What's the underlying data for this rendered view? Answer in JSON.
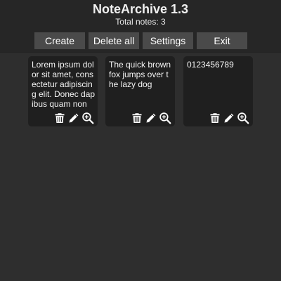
{
  "app": {
    "title": "NoteArchive 1.3",
    "note_count_text": "Total notes: 3"
  },
  "toolbar": {
    "create_label": "Create",
    "delete_all_label": "Delete all",
    "settings_label": "Settings",
    "exit_label": "Exit"
  },
  "notes": [
    {
      "text": "Lorem ipsum dolor sit amet, consectetur adipiscing elit. Donec dapibus quam non",
      "actions": [
        "trash-icon",
        "pencil-icon",
        "zoom-in-icon"
      ]
    },
    {
      "text": "The quick brown fox jumps over the lazy dog",
      "actions": [
        "trash-icon",
        "pencil-icon",
        "zoom-in-icon"
      ]
    },
    {
      "text": "0123456789",
      "actions": [
        "trash-icon",
        "pencil-icon",
        "zoom-in-icon"
      ]
    }
  ],
  "colors": {
    "background": "#2e2e2e",
    "header": "#262626",
    "button": "#4a4a4a",
    "card": "#1f1f1f",
    "text": "#ffffff"
  }
}
